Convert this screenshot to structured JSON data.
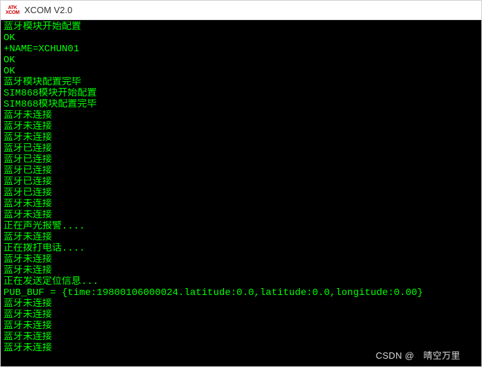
{
  "titlebar": {
    "icon_top": "ATK",
    "icon_bottom": "XCOM",
    "title": "XCOM V2.0"
  },
  "terminal": {
    "lines": [
      "蓝牙模块开始配置",
      "OK",
      "+NAME=XCHUN01",
      "OK",
      "OK",
      "蓝牙模块配置完毕",
      "SIM868模块开始配置",
      "SIM868模块配置完毕",
      "蓝牙未连接",
      "蓝牙未连接",
      "蓝牙未连接",
      "蓝牙已连接",
      "蓝牙已连接",
      "蓝牙已连接",
      "蓝牙已连接",
      "蓝牙已连接",
      "蓝牙未连接",
      "蓝牙未连接",
      "正在声光报警....",
      "蓝牙未连接",
      "正在拨打电话....",
      "蓝牙未连接",
      "蓝牙未连接",
      "正在发送定位信息...",
      "PUB_BUF = {time:19800106000024.latitude:0.0,latitude:0.0,longitude:0.00}",
      "蓝牙未连接",
      "蓝牙未连接",
      "蓝牙未连接",
      "蓝牙未连接",
      "蓝牙未连接"
    ]
  },
  "watermark": {
    "text": "CSDN @ 晴空万里 "
  }
}
